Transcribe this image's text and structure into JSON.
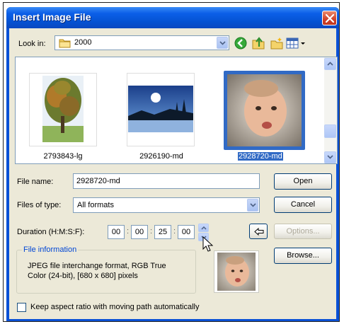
{
  "window": {
    "title": "Insert Image File"
  },
  "look_in": {
    "label": "Look in:",
    "value": "2000"
  },
  "files": [
    {
      "name": "2793843-lg",
      "selected": false
    },
    {
      "name": "2926190-md",
      "selected": false
    },
    {
      "name": "2928720-md",
      "selected": true
    }
  ],
  "file_name": {
    "label": "File name:",
    "value": "2928720-md"
  },
  "file_type": {
    "label": "Files of type:",
    "value": "All formats"
  },
  "duration": {
    "label": "Duration (H:M:S:F):",
    "h": "00",
    "m": "00",
    "s": "25",
    "f": "00"
  },
  "buttons": {
    "open": "Open",
    "cancel": "Cancel",
    "options": "Options...",
    "browse": "Browse..."
  },
  "file_info": {
    "title": "File information",
    "line1": "JPEG file interchange format,  RGB True",
    "line2": "Color (24-bit),  [680 x 680] pixels"
  },
  "keep_aspect": {
    "label": "Keep aspect ratio with moving path automatically",
    "checked": false
  },
  "colors": {
    "title_bar": "#0552d2",
    "dialog_bg": "#ece9d8",
    "selection": "#316ac5",
    "group_title": "#0046d5"
  }
}
